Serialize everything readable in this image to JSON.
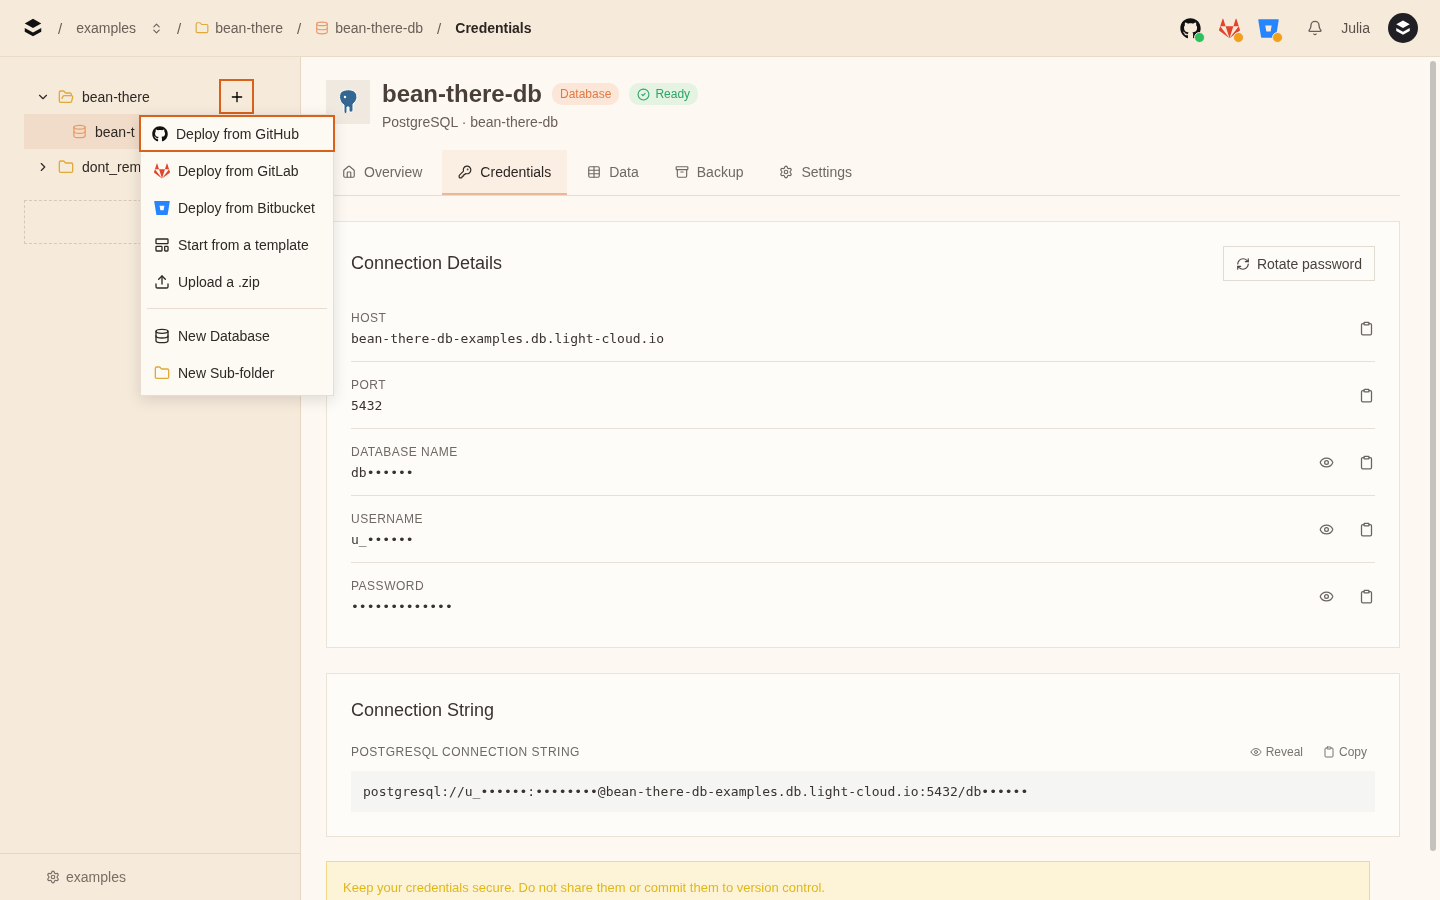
{
  "topbar": {
    "separator": "/",
    "breadcrumb": [
      {
        "label": "examples",
        "kind": "switcher"
      },
      {
        "label": "bean-there",
        "kind": "folder"
      },
      {
        "label": "bean-there-db",
        "kind": "database"
      },
      {
        "label": "Credentials",
        "kind": "current"
      }
    ],
    "integrations": [
      {
        "kind": "github",
        "color": "#2fbf5f"
      },
      {
        "kind": "gitlab",
        "color": "#f2a01c"
      },
      {
        "kind": "bitbucket",
        "color": "#f2a01c"
      }
    ],
    "user": "Julia"
  },
  "sidebar": {
    "tree": [
      {
        "label": "bean-there",
        "kind": "folder",
        "expanded": true,
        "selected": false,
        "children": [
          {
            "label": "bean-t",
            "kind": "database",
            "selected": true
          }
        ]
      },
      {
        "label": "dont_rem",
        "kind": "folder",
        "expanded": false,
        "selected": false
      }
    ],
    "footer": "examples"
  },
  "menu": {
    "groups": [
      [
        {
          "label": "Deploy from GitHub",
          "selected": true
        },
        {
          "label": "Deploy from GitLab",
          "selected": false
        },
        {
          "label": "Deploy from Bitbucket",
          "selected": false
        },
        {
          "label": "Start from a template",
          "selected": false
        },
        {
          "label": "Upload a .zip",
          "selected": false
        }
      ],
      [
        {
          "label": "New Database",
          "selected": false
        },
        {
          "label": "New Sub-folder",
          "selected": false
        }
      ]
    ]
  },
  "header": {
    "title": "bean-there-db",
    "type_badge": "Database",
    "status": "Ready",
    "subtitle": "PostgreSQL · bean-there-db"
  },
  "tabs": [
    {
      "label": "Overview",
      "selected": false
    },
    {
      "label": "Credentials",
      "selected": true
    },
    {
      "label": "Data",
      "selected": false
    },
    {
      "label": "Backup",
      "selected": false
    },
    {
      "label": "Settings",
      "selected": false
    }
  ],
  "connection_details": {
    "title": "Connection Details",
    "button": "Rotate password",
    "fields": [
      {
        "label": "HOST",
        "value": "bean-there-db-examples.db.light-cloud.io",
        "revealable": false
      },
      {
        "label": "PORT",
        "value": "5432",
        "revealable": false
      },
      {
        "label": "DATABASE NAME",
        "value": "db••••••",
        "revealable": true
      },
      {
        "label": "USERNAME",
        "value": "u_••••••",
        "revealable": true
      },
      {
        "label": "PASSWORD",
        "value": "•••••••••••••",
        "revealable": true
      }
    ]
  },
  "connection_string": {
    "title": "Connection String",
    "label": "POSTGRESQL CONNECTION STRING",
    "reveal": "Reveal",
    "copy": "Copy",
    "value": "postgresql://u_••••••:••••••••@bean-there-db-examples.db.light-cloud.io:5432/db••••••"
  },
  "warning": "Keep your credentials secure. Do not share them or commit them to version control."
}
